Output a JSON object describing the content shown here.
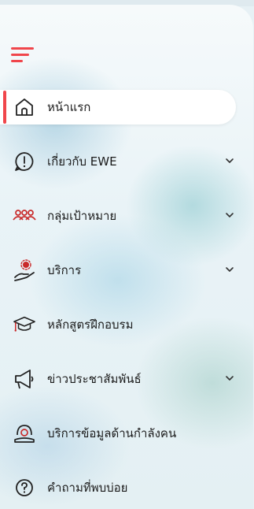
{
  "menu": {
    "toggle_icon": "hamburger-menu-icon",
    "accent_color": "#f0464b",
    "items": [
      {
        "label": "หน้าแรก",
        "icon": "home-icon",
        "active": true,
        "has_submenu": false
      },
      {
        "label": "เกี่ยวกับ EWE",
        "icon": "info-circle-icon",
        "active": false,
        "has_submenu": true
      },
      {
        "label": "กลุ่มเป้าหมาย",
        "icon": "people-group-icon",
        "active": false,
        "has_submenu": true
      },
      {
        "label": "บริการ",
        "icon": "service-hand-icon",
        "active": false,
        "has_submenu": true
      },
      {
        "label": "หลักสูตรฝึกอบรม",
        "icon": "graduation-cap-icon",
        "active": false,
        "has_submenu": false
      },
      {
        "label": "ข่าวประชาสัมพันธ์",
        "icon": "megaphone-icon",
        "active": false,
        "has_submenu": true
      },
      {
        "label": "บริการข้อมูลด้านกำลังคน",
        "icon": "workforce-data-icon",
        "active": false,
        "has_submenu": false
      },
      {
        "label": "คำถามที่พบบ่อย",
        "icon": "question-circle-icon",
        "active": false,
        "has_submenu": false
      }
    ]
  }
}
